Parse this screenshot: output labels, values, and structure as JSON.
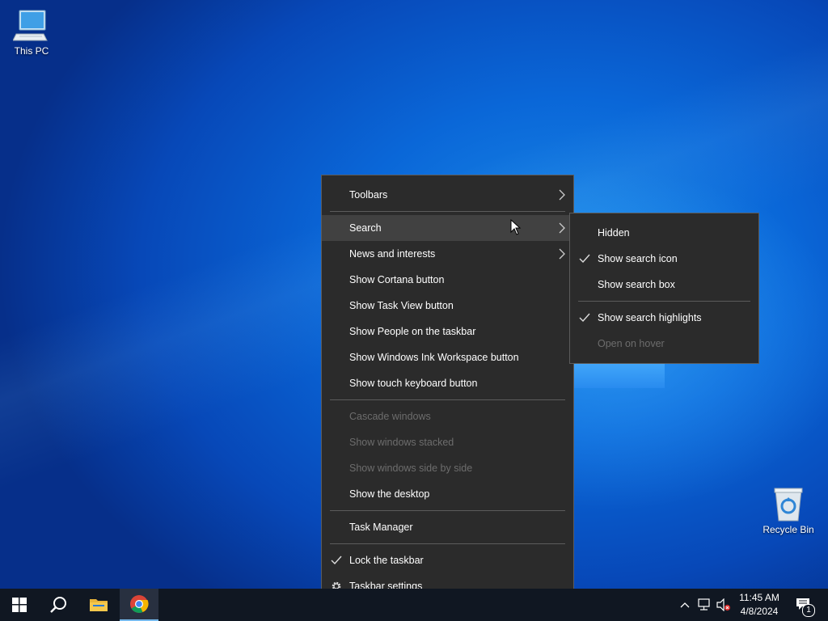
{
  "desktop": {
    "icons": [
      {
        "label": "This PC"
      },
      {
        "label": "Recycle Bin"
      }
    ]
  },
  "context_menu": {
    "items": [
      {
        "label": "Toolbars",
        "submenu": true,
        "disabled": false,
        "checked": false
      },
      {
        "label": "Search",
        "submenu": true,
        "disabled": false,
        "checked": false,
        "hovered": true
      },
      {
        "label": "News and interests",
        "submenu": true,
        "disabled": false,
        "checked": false
      },
      {
        "label": "Show Cortana button",
        "disabled": false
      },
      {
        "label": "Show Task View button",
        "disabled": false
      },
      {
        "label": "Show People on the taskbar",
        "disabled": false
      },
      {
        "label": "Show Windows Ink Workspace button",
        "disabled": false
      },
      {
        "label": "Show touch keyboard button",
        "disabled": false
      },
      {
        "label": "Cascade windows",
        "disabled": true
      },
      {
        "label": "Show windows stacked",
        "disabled": true
      },
      {
        "label": "Show windows side by side",
        "disabled": true
      },
      {
        "label": "Show the desktop",
        "disabled": false
      },
      {
        "label": "Task Manager",
        "disabled": false
      },
      {
        "label": "Lock the taskbar",
        "disabled": false,
        "checked": true
      },
      {
        "label": "Taskbar settings",
        "disabled": false,
        "icon": "gear-icon"
      }
    ]
  },
  "search_submenu": {
    "items": [
      {
        "label": "Hidden",
        "checked": false,
        "disabled": false
      },
      {
        "label": "Show search icon",
        "checked": true,
        "disabled": false
      },
      {
        "label": "Show search box",
        "checked": false,
        "disabled": false
      },
      {
        "label": "Show search highlights",
        "checked": true,
        "disabled": false
      },
      {
        "label": "Open on hover",
        "checked": false,
        "disabled": true
      }
    ]
  },
  "taskbar": {
    "pinned": [
      "windows-start-icon",
      "search-icon",
      "file-explorer-icon",
      "chrome-icon"
    ],
    "tray": {
      "time": "11:45 AM",
      "date": "4/8/2024",
      "notification_count": "1"
    }
  },
  "colors": {
    "menu_bg": "#2b2b2b",
    "menu_hover": "#414141",
    "taskbar_bg": "#101722",
    "disabled_text": "#6d6d6d"
  }
}
